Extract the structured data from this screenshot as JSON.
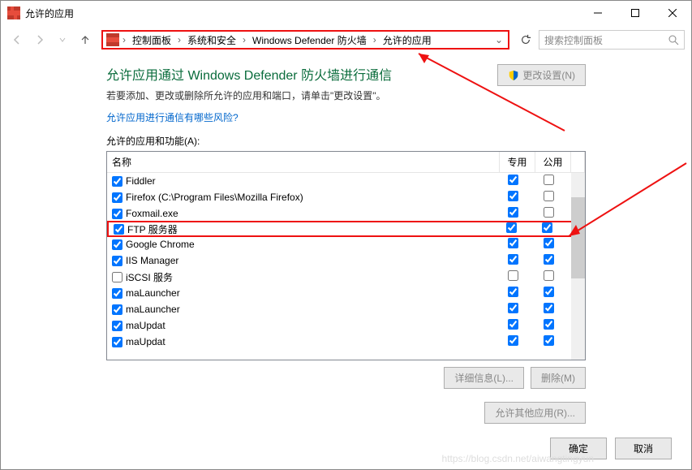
{
  "window": {
    "title": "允许的应用"
  },
  "breadcrumb": {
    "items": [
      "控制面板",
      "系统和安全",
      "Windows Defender 防火墙",
      "允许的应用"
    ]
  },
  "search": {
    "placeholder": "搜索控制面板"
  },
  "page": {
    "heading": "允许应用通过 Windows Defender 防火墙进行通信",
    "subtext": "若要添加、更改或删除所允许的应用和端口，请单击\"更改设置\"。",
    "risk_link": "允许应用进行通信有哪些风险?",
    "change_settings_btn": "更改设置(N)",
    "list_label": "允许的应用和功能(A):",
    "col_name": "名称",
    "col_private": "专用",
    "col_public": "公用",
    "details_btn": "详细信息(L)...",
    "remove_btn": "删除(M)",
    "allow_other_btn": "允许其他应用(R)...",
    "ok_btn": "确定",
    "cancel_btn": "取消"
  },
  "apps": [
    {
      "name": "Fiddler",
      "enabled": true,
      "private": true,
      "public": false,
      "hl": false
    },
    {
      "name": "Firefox (C:\\Program Files\\Mozilla Firefox)",
      "enabled": true,
      "private": true,
      "public": false,
      "hl": false
    },
    {
      "name": "Foxmail.exe",
      "enabled": true,
      "private": true,
      "public": false,
      "hl": false
    },
    {
      "name": "FTP 服务器",
      "enabled": true,
      "private": true,
      "public": true,
      "hl": true
    },
    {
      "name": "Google Chrome",
      "enabled": true,
      "private": true,
      "public": true,
      "hl": false
    },
    {
      "name": "IIS Manager",
      "enabled": true,
      "private": true,
      "public": true,
      "hl": false
    },
    {
      "name": "iSCSI 服务",
      "enabled": false,
      "private": false,
      "public": false,
      "hl": false
    },
    {
      "name": "maLauncher",
      "enabled": true,
      "private": true,
      "public": true,
      "hl": false
    },
    {
      "name": "maLauncher",
      "enabled": true,
      "private": true,
      "public": true,
      "hl": false
    },
    {
      "name": "maUpdat",
      "enabled": true,
      "private": true,
      "public": true,
      "hl": false
    },
    {
      "name": "maUpdat",
      "enabled": true,
      "private": true,
      "public": true,
      "hl": false
    }
  ],
  "watermark": "https://blog.csdn.net/aiwangtingyun"
}
